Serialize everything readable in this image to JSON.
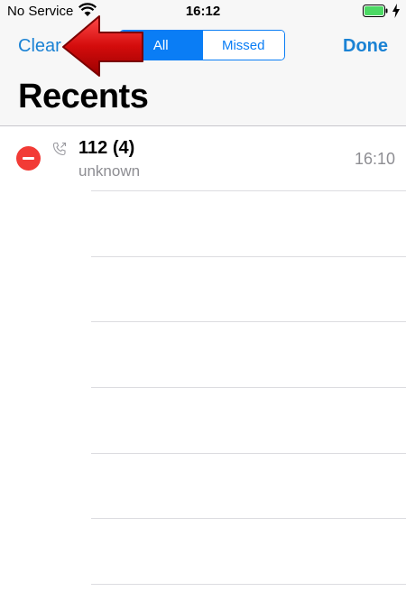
{
  "status_bar": {
    "carrier": "No Service",
    "time": "16:12"
  },
  "nav": {
    "clear_label": "Clear",
    "done_label": "Done",
    "segments": [
      "All",
      "Missed"
    ],
    "selected_segment": "All"
  },
  "title": "Recents",
  "calls": [
    {
      "number": "112 (4)",
      "label": "unknown",
      "time": "16:10"
    }
  ],
  "colors": {
    "accent": "#0a7df5",
    "delete": "#f23b36",
    "annotation_arrow": "#d01010"
  },
  "icons": [
    "wifi-icon",
    "battery-icon",
    "charging-bolt-icon",
    "outgoing-call-icon",
    "delete-minus-icon",
    "annotation-arrow-icon"
  ]
}
